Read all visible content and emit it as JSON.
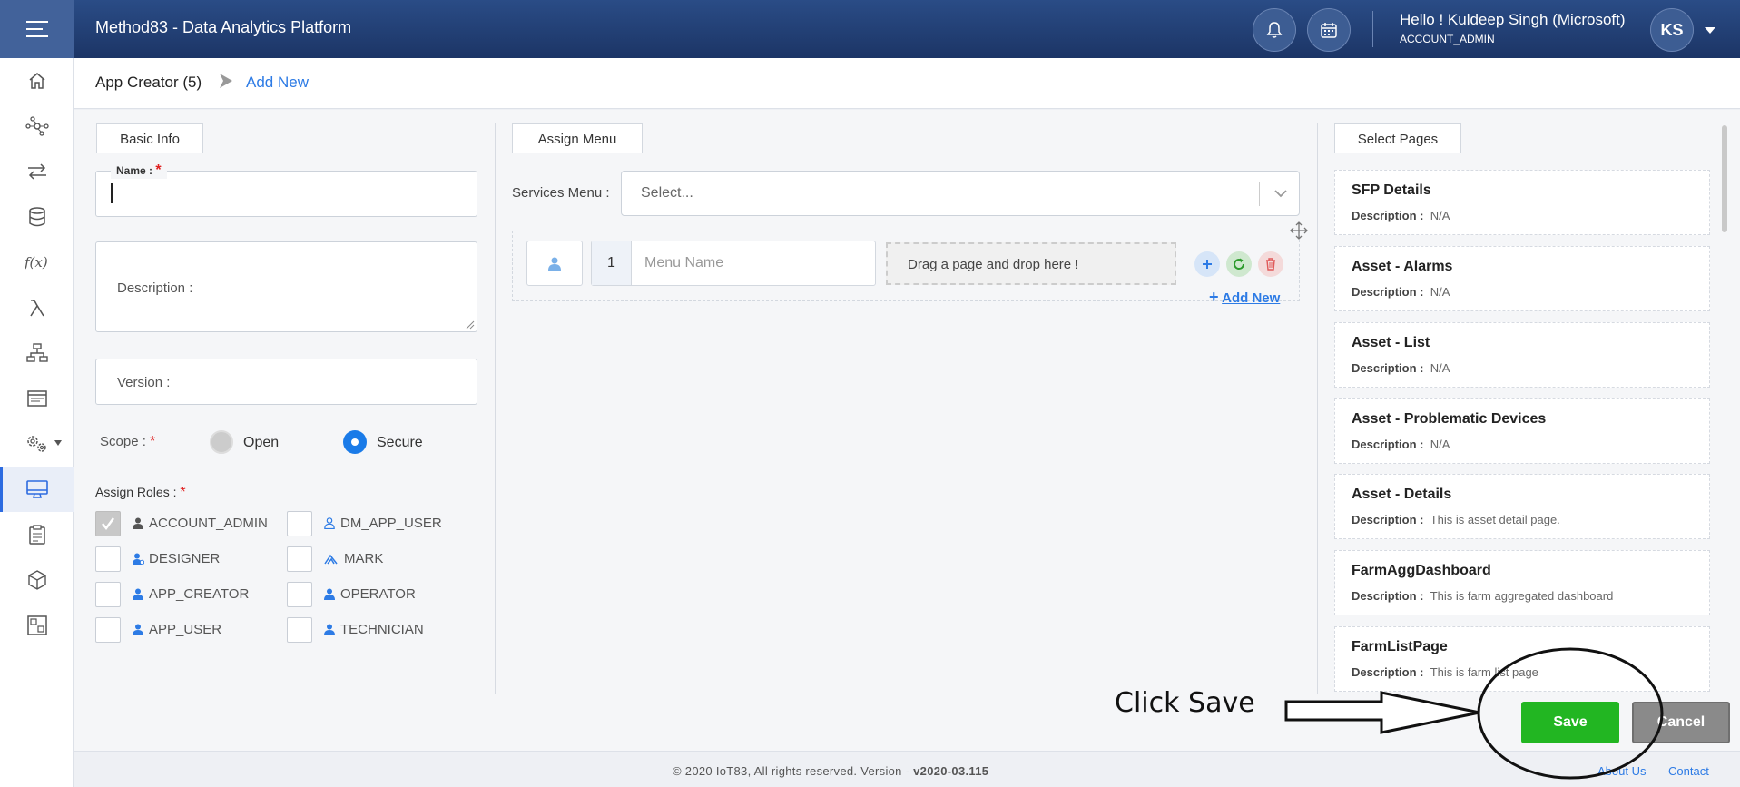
{
  "header": {
    "title": "Method83 - Data Analytics Platform",
    "greeting": "Hello ! Kuldeep Singh (Microsoft)",
    "role": "ACCOUNT_ADMIN",
    "avatar_initials": "KS"
  },
  "sidebar": {
    "items": [
      "home-icon",
      "network-icon",
      "transfer-icon",
      "database-icon",
      "function-icon",
      "lambda-icon",
      "hierarchy-icon",
      "window-icon",
      "settings-gear-icon",
      "monitor-icon",
      "clipboard-icon",
      "cube-icon",
      "dashboard-icon"
    ],
    "active_index": 9
  },
  "breadcrumb": {
    "main": "App Creator (5)",
    "sub": "Add New"
  },
  "basic_info": {
    "tab": "Basic Info",
    "name_label": "Name :",
    "description_label": "Description :",
    "version_label": "Version :",
    "scope_label": "Scope :",
    "scope_open": "Open",
    "scope_secure": "Secure",
    "selected_scope": "Secure",
    "roles_label": "Assign Roles :",
    "roles": [
      {
        "name": "ACCOUNT_ADMIN",
        "checked": true
      },
      {
        "name": "DM_APP_USER",
        "checked": false
      },
      {
        "name": "DESIGNER",
        "checked": false
      },
      {
        "name": "MARK",
        "checked": false
      },
      {
        "name": "APP_CREATOR",
        "checked": false
      },
      {
        "name": "OPERATOR",
        "checked": false
      },
      {
        "name": "APP_USER",
        "checked": false
      },
      {
        "name": "TECHNICIAN",
        "checked": false
      }
    ]
  },
  "assign_menu": {
    "tab": "Assign Menu",
    "services_label": "Services Menu :",
    "services_placeholder": "Select...",
    "row_number": "1",
    "menu_name_placeholder": "Menu Name",
    "drop_text": "Drag a page and drop here !",
    "add_new": "Add New"
  },
  "select_pages": {
    "tab": "Select Pages",
    "desc_label": "Description :",
    "pages": [
      {
        "title": "SFP Details",
        "desc": "N/A"
      },
      {
        "title": "Asset - Alarms",
        "desc": "N/A"
      },
      {
        "title": "Asset - List",
        "desc": "N/A"
      },
      {
        "title": "Asset - Problematic Devices",
        "desc": "N/A"
      },
      {
        "title": "Asset - Details",
        "desc": "This is asset detail page."
      },
      {
        "title": "FarmAggDashboard",
        "desc": "This is farm aggregated dashboard"
      },
      {
        "title": "FarmListPage",
        "desc": "This is farm list page"
      }
    ]
  },
  "actions": {
    "save": "Save",
    "cancel": "Cancel"
  },
  "annotation": {
    "text": "Click Save"
  },
  "footer": {
    "copyright": "© 2020 IoT83, All rights reserved. Version - ",
    "version": "v2020-03.115",
    "about": "About Us",
    "contact": "Contact"
  },
  "colors": {
    "header": "#1c3566",
    "accent": "#2d7be5",
    "save": "#22b622",
    "cancel": "#8a8a8a"
  }
}
